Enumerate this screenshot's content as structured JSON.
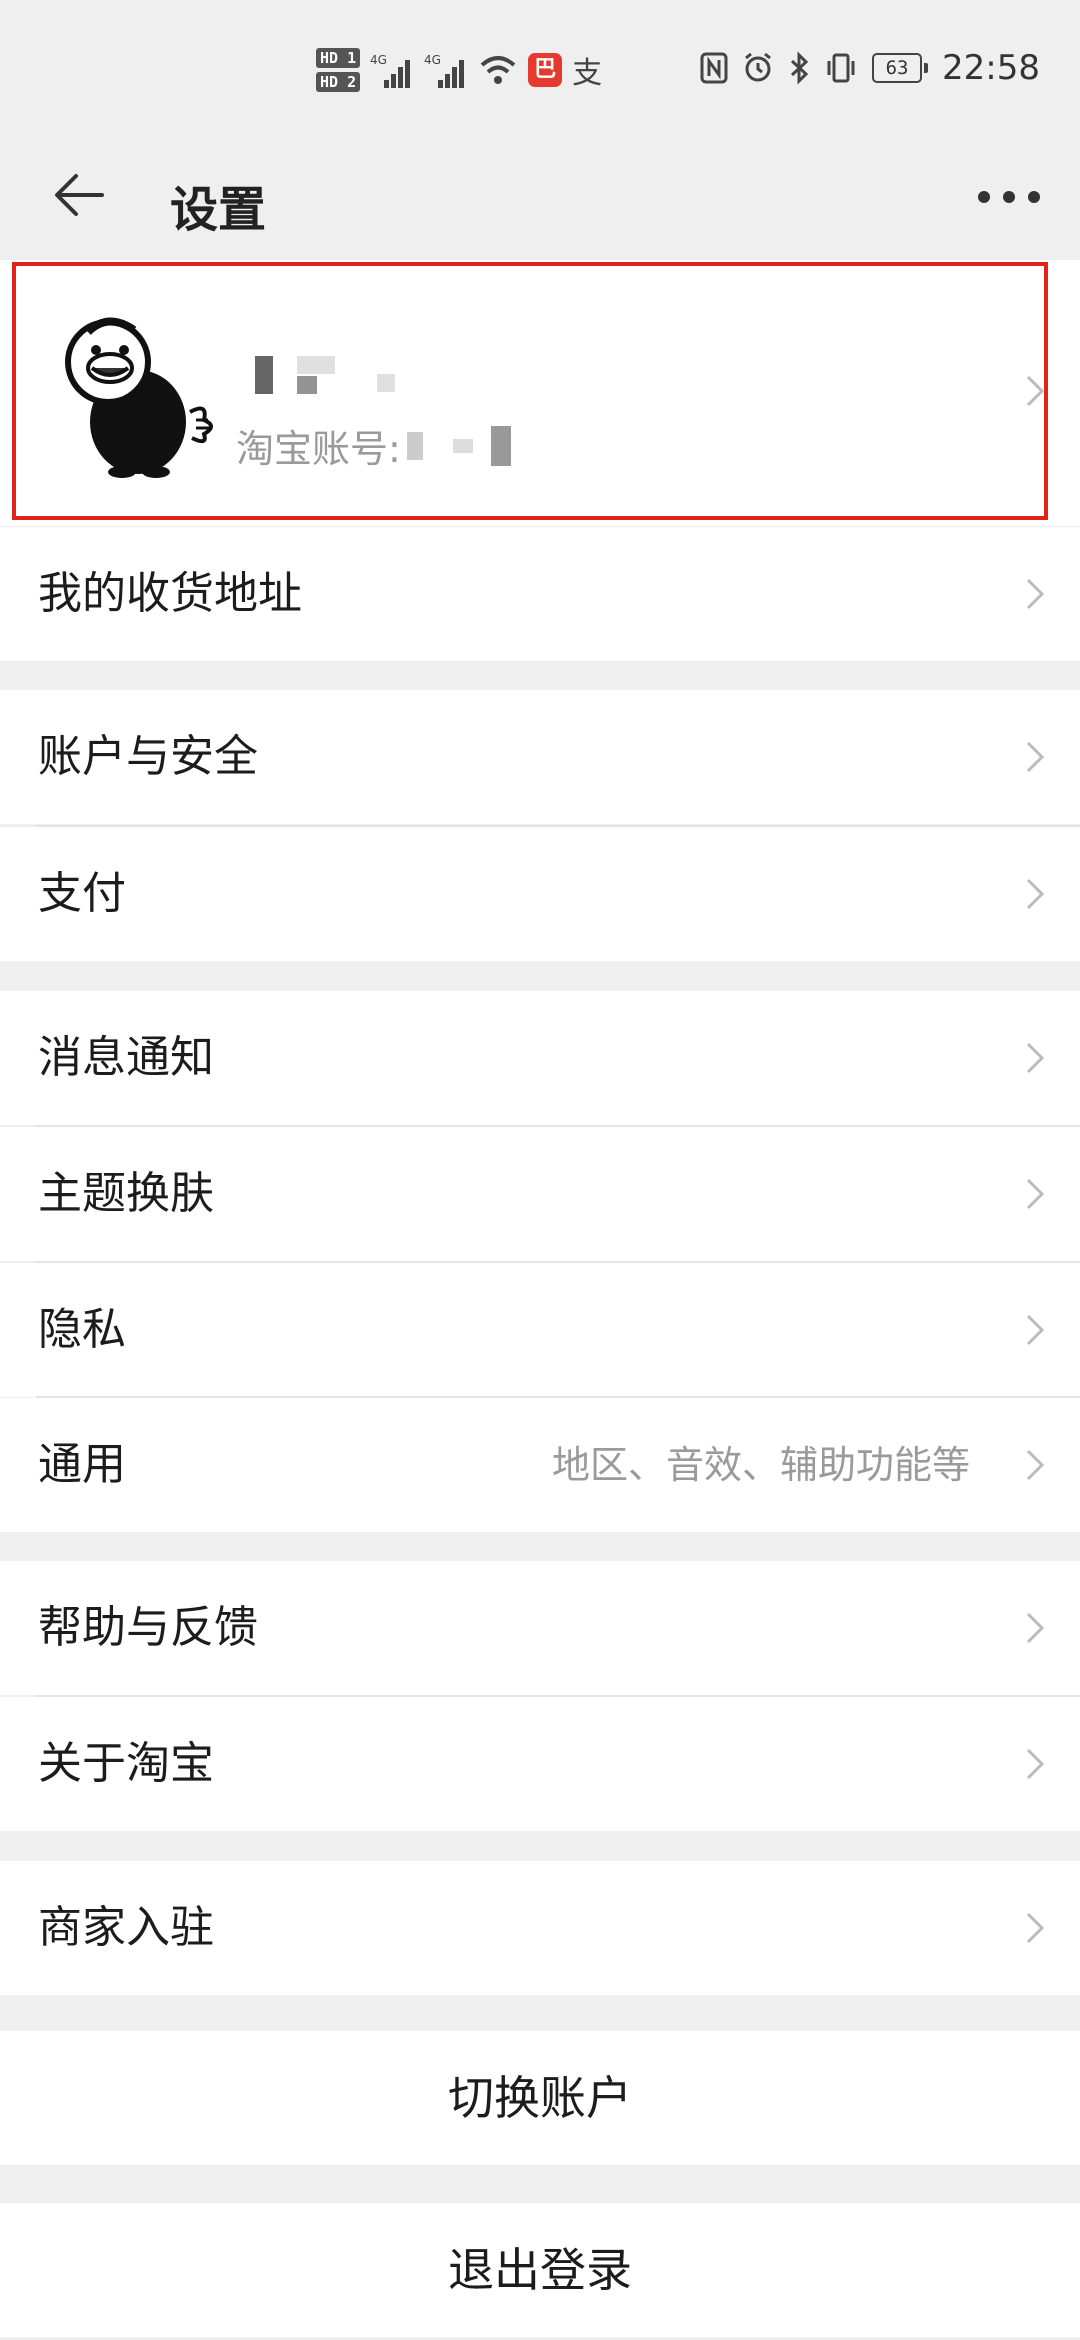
{
  "status_bar": {
    "hd1": "HD 1",
    "hd2": "HD 2",
    "net1": "4G",
    "net2": "4G",
    "app_icon_glyph": "巴",
    "alipay_glyph": "支",
    "battery": "63",
    "time": "22:58",
    "icons": [
      "signal-icon",
      "signal-icon",
      "wifi-icon",
      "nfc-icon",
      "alarm-icon",
      "bluetooth-icon",
      "vibrate-icon",
      "battery-icon"
    ]
  },
  "appbar": {
    "title": "设置",
    "back_icon": "arrow-left-icon",
    "more_icon": "more-horizontal-icon"
  },
  "profile": {
    "account_label": "淘宝账号:",
    "highlight_color": "#e3221b"
  },
  "menu": {
    "address": "我的收货地址",
    "account_security": "账户与安全",
    "payment": "支付",
    "notifications": "消息通知",
    "theme": "主题换肤",
    "privacy": "隐私",
    "general": "通用",
    "general_hint": "地区、音效、辅助功能等",
    "help": "帮助与反馈",
    "about": "关于淘宝",
    "merchant": "商家入驻"
  },
  "actions": {
    "switch_account": "切换账户",
    "logout": "退出登录"
  }
}
